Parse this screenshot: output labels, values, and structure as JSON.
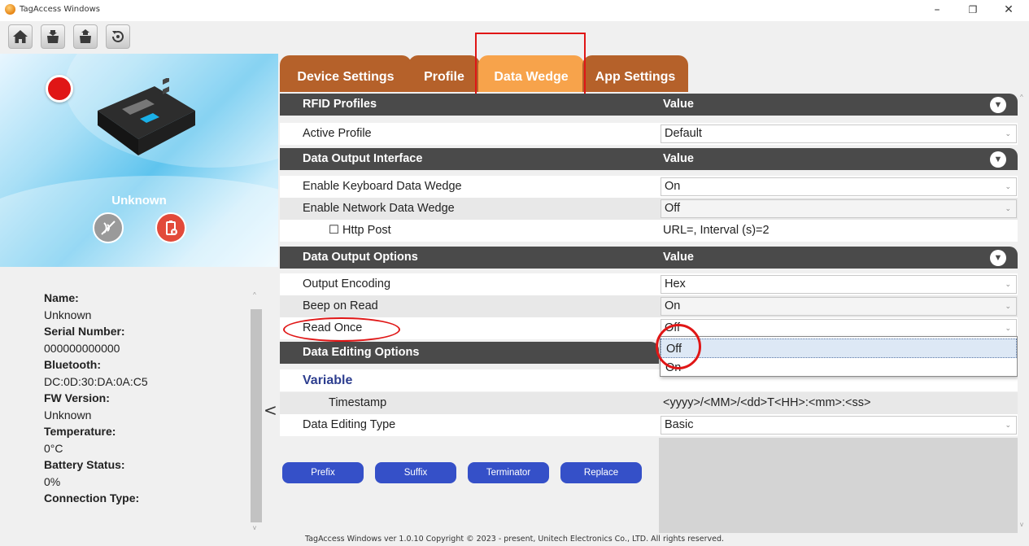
{
  "window": {
    "title": "TagAccess Windows",
    "minimize": "–",
    "restore": "❐",
    "close": "✕"
  },
  "toolbar": {
    "icons": [
      "home-icon",
      "import-icon",
      "export-icon",
      "refresh-icon"
    ]
  },
  "device": {
    "name": "Unknown",
    "info": [
      {
        "label": "Name:",
        "value": "Unknown"
      },
      {
        "label": "Serial Number:",
        "value": "000000000000"
      },
      {
        "label": "Bluetooth:",
        "value": "DC:0D:30:DA:0A:C5"
      },
      {
        "label": "FW Version:",
        "value": "Unknown"
      },
      {
        "label": "Temperature:",
        "value": "0°C"
      },
      {
        "label": "Battery Status:",
        "value": "0%"
      },
      {
        "label": "Connection Type:",
        "value": ""
      }
    ],
    "collapse": "<"
  },
  "tabs": [
    "Device Settings",
    "Profile",
    "Data Wedge",
    "App Settings"
  ],
  "sections": {
    "rfid": {
      "title": "RFID Profiles",
      "value_header": "Value"
    },
    "output_iface": {
      "title": "Data Output Interface",
      "value_header": "Value"
    },
    "output_opts": {
      "title": "Data Output Options",
      "value_header": "Value"
    },
    "editing": {
      "title": "Data Editing Options"
    }
  },
  "rows": {
    "active_profile": {
      "label": "Active Profile",
      "value": "Default"
    },
    "keyboard_wedge": {
      "label": "Enable Keyboard Data Wedge",
      "value": "On"
    },
    "network_wedge": {
      "label": "Enable Network Data Wedge",
      "value": "Off"
    },
    "http_post": {
      "label": "Http Post",
      "checkbox": "☐",
      "value": "URL=, Interval (s)=2"
    },
    "output_encoding": {
      "label": "Output Encoding",
      "value": "Hex"
    },
    "beep_on_read": {
      "label": "Beep on Read",
      "value": "On"
    },
    "read_once": {
      "label": "Read Once",
      "value": "Off"
    },
    "variable": {
      "label": "Variable"
    },
    "timestamp": {
      "label": "Timestamp",
      "value": "<yyyy>/<MM>/<dd>T<HH>:<mm>:<ss>"
    },
    "editing_type": {
      "label": "Data Editing Type",
      "value": "Basic"
    }
  },
  "dropdown": {
    "options": [
      "Off",
      "On"
    ],
    "selected": "Off"
  },
  "buttons": {
    "prefix": "Prefix",
    "suffix": "Suffix",
    "terminator": "Terminator",
    "replace": "Replace"
  },
  "footer": "TagAccess Windows ver 1.0.10 Copyright © 2023 - present, Unitech Electronics Co., LTD. All rights reserved.",
  "colors": {
    "tab": "#b5612a",
    "tab_active": "#f7a34b",
    "section_header": "#4a4a4a",
    "button": "#3550c8",
    "annotation": "#e01616"
  }
}
